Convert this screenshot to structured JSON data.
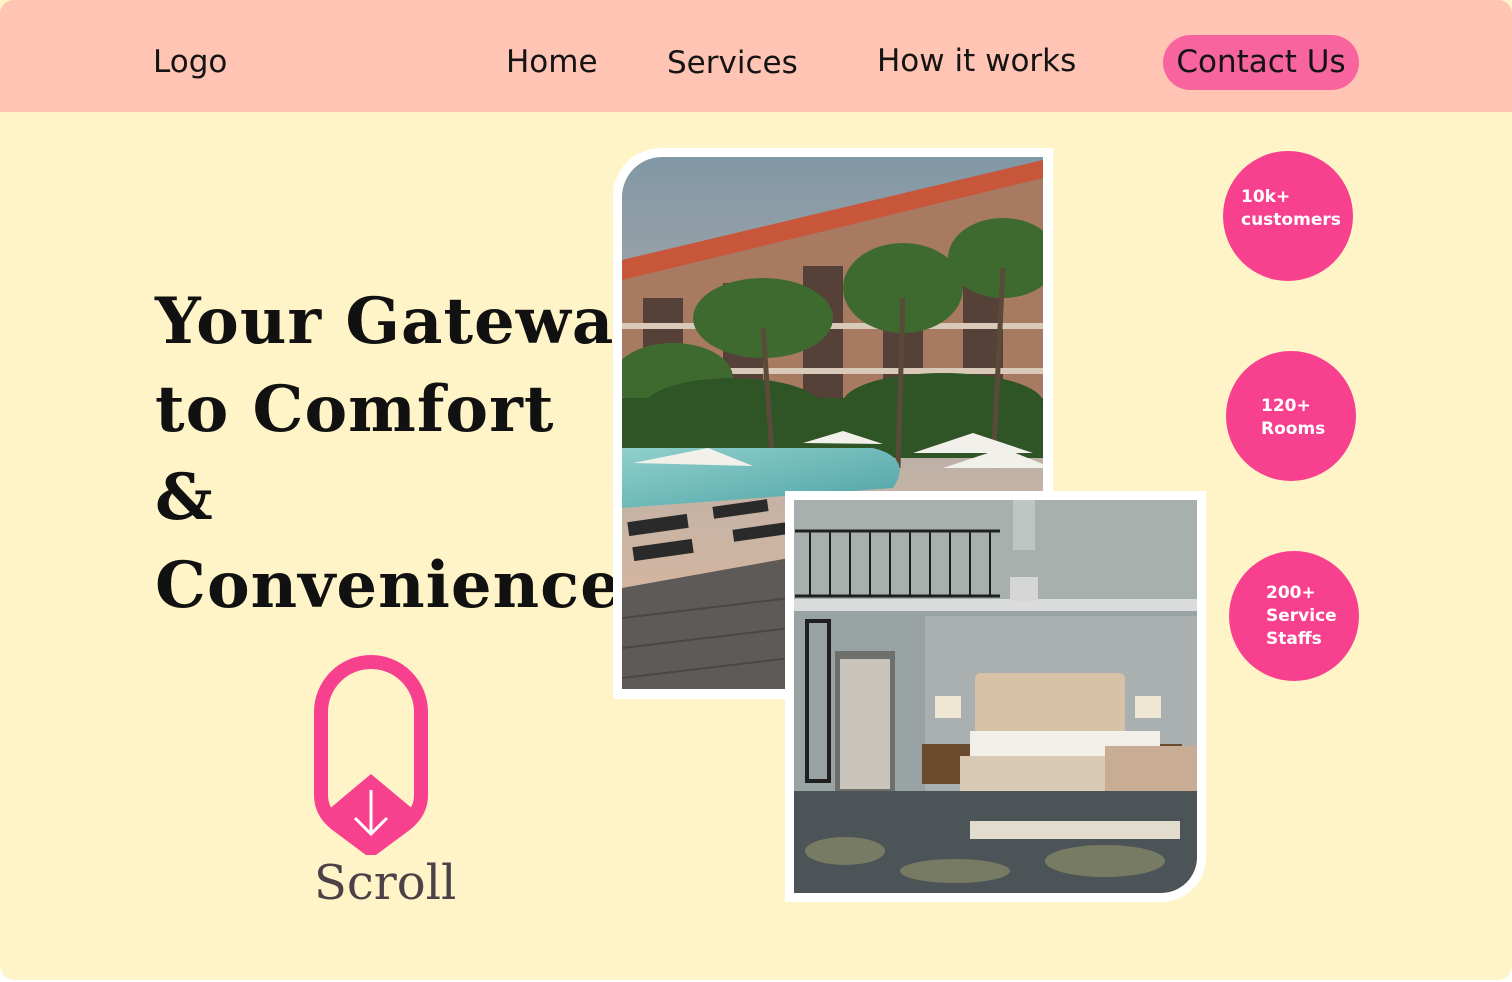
{
  "nav": {
    "logo": "Logo",
    "links": [
      "Home",
      "Services",
      "How it works"
    ],
    "cta": "Contact Us"
  },
  "hero": {
    "title_lines": [
      "Your Gateway",
      "to Comfort",
      "&",
      "Convenience"
    ],
    "scroll_label": "Scroll"
  },
  "stats": [
    {
      "text": "10k+\ncustomers"
    },
    {
      "text": "120+\nRooms"
    },
    {
      "text": "200+\nService\nStaffs"
    }
  ],
  "images": {
    "resort": "resort-pool-photo",
    "bedroom": "bedroom-photo"
  },
  "colors": {
    "nav_bg": "#ffc4b4",
    "page_bg": "#fff4c8",
    "accent_pink": "#f8418e",
    "cta_pink": "#f7649e"
  }
}
